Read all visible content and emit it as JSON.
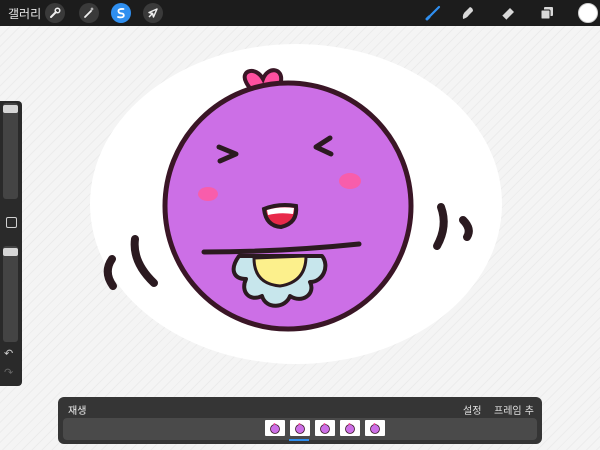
{
  "topbar": {
    "gallery_label": "갤러리",
    "left_tools": [
      {
        "icon": "wrench-icon",
        "active": false
      },
      {
        "icon": "magic-wand-icon",
        "active": false
      },
      {
        "icon": "selection-icon",
        "active": true
      },
      {
        "icon": "transform-icon",
        "active": false
      }
    ],
    "right_tools": [
      "brush-icon",
      "smudge-icon",
      "eraser-icon",
      "layers-icon"
    ],
    "current_color": "#ffffff"
  },
  "sidebar": {
    "brush_size_slider": {
      "level": 0.95
    },
    "opacity_slider": {
      "level": 1.0
    },
    "modify_button": "square-icon",
    "undo": "undo-icon",
    "redo": "redo-icon",
    "undo_glyph": "↶",
    "redo_glyph": "↷"
  },
  "animation": {
    "play_label": "재생",
    "settings_label": "설정",
    "add_frame_label": "프레임 추가",
    "frame_count": 5,
    "selected_frame": 2
  },
  "colors": {
    "accent": "#2f8ff0",
    "character_fill": "#cc6fe6",
    "character_outline": "#3a1626",
    "heart": "#ff4fa0",
    "blush": "#ff5aa0",
    "bib_yellow": "#fcf08c",
    "bib_blue": "#c7e6ec"
  }
}
